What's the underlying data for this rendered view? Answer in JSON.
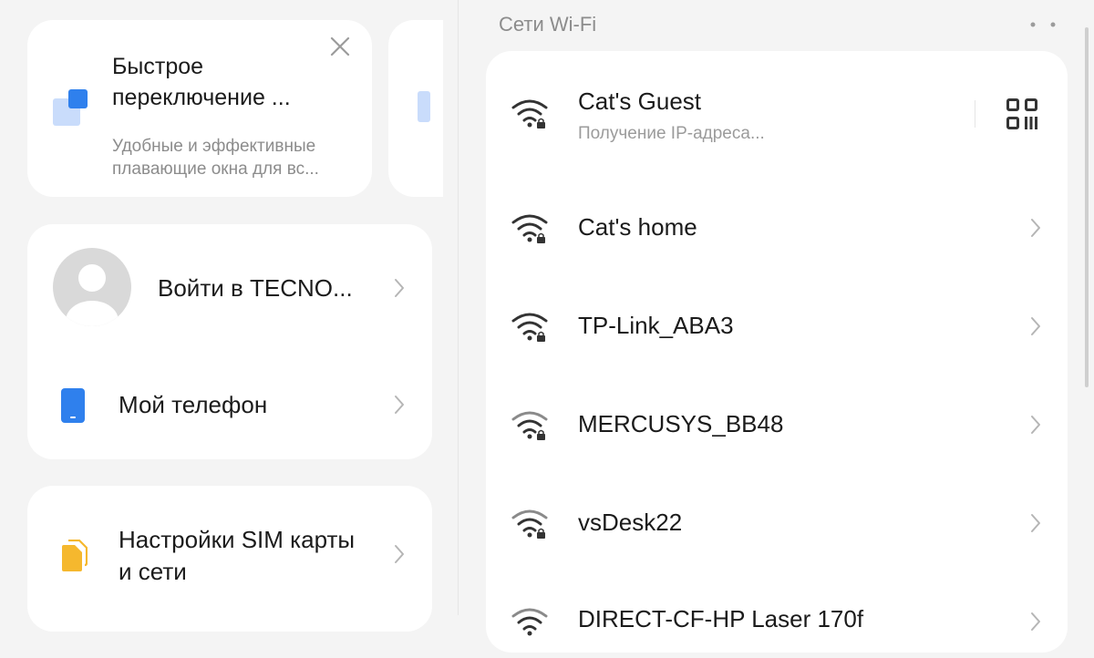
{
  "promo": {
    "title": "Быстрое переключение ...",
    "description": "Удобные и эффективные плавающие окна для вс..."
  },
  "account": {
    "login_label": "Войти в TECNO...",
    "my_phone_label": "Мой телефон"
  },
  "sim": {
    "label": "Настройки SIM карты и сети"
  },
  "wifi": {
    "header": "Сети Wi-Fi",
    "networks": [
      {
        "name": "Cat's Guest",
        "status": "Получение IP-адреса..."
      },
      {
        "name": "Cat's home"
      },
      {
        "name": "TP-Link_ABA3"
      },
      {
        "name": "MERCUSYS_BB48"
      },
      {
        "name": "vsDesk22"
      },
      {
        "name": "DIRECT-CF-HP Laser 170f"
      }
    ]
  },
  "colors": {
    "accent_blue": "#2f80ed",
    "sim_yellow": "#f5b82e",
    "background": "#f4f4f4",
    "card": "#ffffff"
  },
  "icons": [
    "close-icon",
    "avatar",
    "phone-icon",
    "sim-icon",
    "wifi-lock-icon",
    "qr-code-icon",
    "chevron-right-icon",
    "more-icon"
  ]
}
